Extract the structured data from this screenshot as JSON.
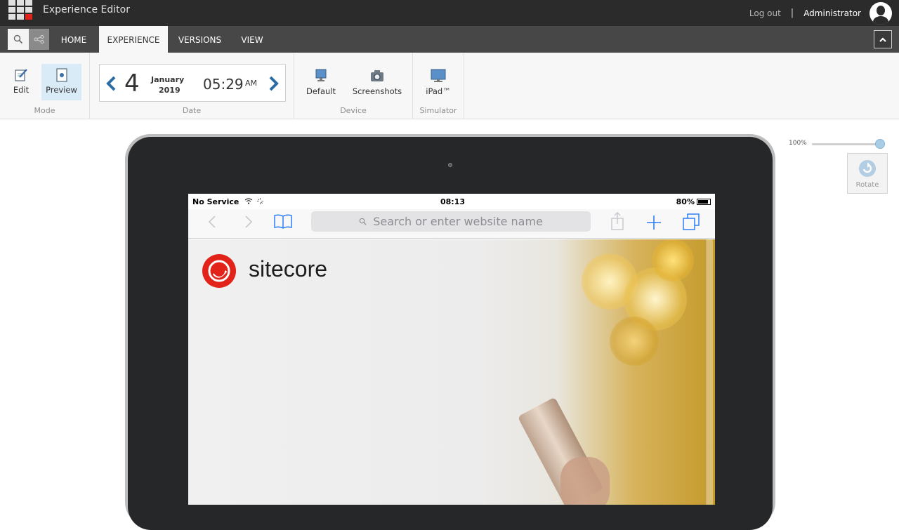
{
  "topbar": {
    "app_title": "Experience Editor",
    "logout": "Log out",
    "separator": "|",
    "user": "Administrator"
  },
  "tabs": [
    {
      "label": "HOME",
      "active": false
    },
    {
      "label": "EXPERIENCE",
      "active": true
    },
    {
      "label": "VERSIONS",
      "active": false
    },
    {
      "label": "VIEW",
      "active": false
    }
  ],
  "ribbon": {
    "mode": {
      "group_label": "Mode",
      "edit_label": "Edit",
      "preview_label": "Preview",
      "selected": "Preview"
    },
    "date": {
      "group_label": "Date",
      "day": "4",
      "month": "January",
      "year": "2019",
      "time": "05:29",
      "ampm": "AM"
    },
    "device": {
      "group_label": "Device",
      "default_label": "Default",
      "screenshots_label": "Screenshots"
    },
    "simulator": {
      "group_label": "Simulator",
      "ipad_label": "iPad™"
    }
  },
  "zoom": {
    "label": "100%",
    "level": 1.0
  },
  "rotate": {
    "label": "Rotate"
  },
  "device_screen": {
    "status": {
      "carrier": "No Service",
      "time": "08:13",
      "battery": "80%"
    },
    "url_placeholder": "Search or enter website name",
    "site_logo_text": "sitecore"
  },
  "colors": {
    "accent_blue": "#2d6ca2",
    "sitecore_red": "#e2231a",
    "topbar": "#2b2b2b",
    "tabbar": "#474747",
    "preview_highlight": "#d9ebf7"
  }
}
